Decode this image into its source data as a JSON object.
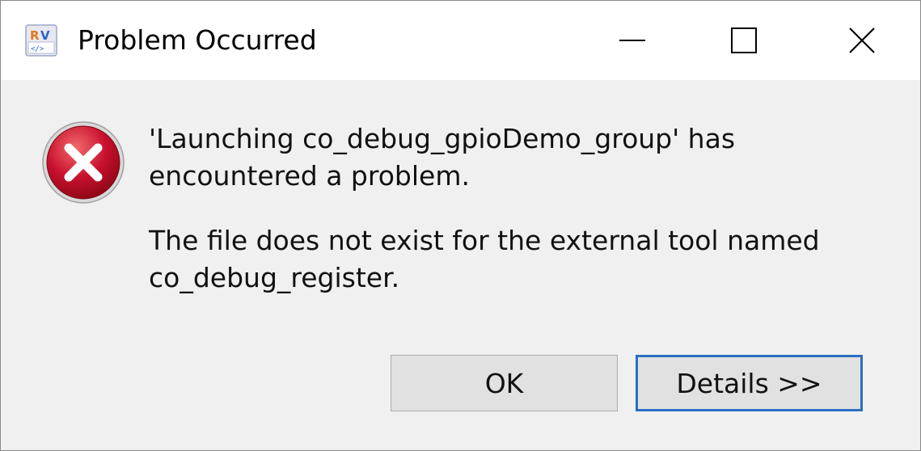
{
  "window": {
    "title": "Problem Occurred",
    "app_icon": "rv-app-icon"
  },
  "titlebar_buttons": {
    "minimize": "minimize-icon",
    "maximize": "maximize-icon",
    "close": "close-icon"
  },
  "dialog": {
    "icon": "error-icon",
    "message_line1": "'Launching co_debug_gpioDemo_group' has",
    "message_line2": "encountered a problem.",
    "detail_line1": "The file does not exist for the external tool named",
    "detail_line2": "co_debug_register."
  },
  "buttons": {
    "ok_label": "OK",
    "details_label": "Details >>"
  },
  "colors": {
    "dialog_background": "#f0f0f0",
    "titlebar_background": "#ffffff",
    "focused_button_border": "#2a6fc4",
    "error_red": "#c8102e"
  }
}
